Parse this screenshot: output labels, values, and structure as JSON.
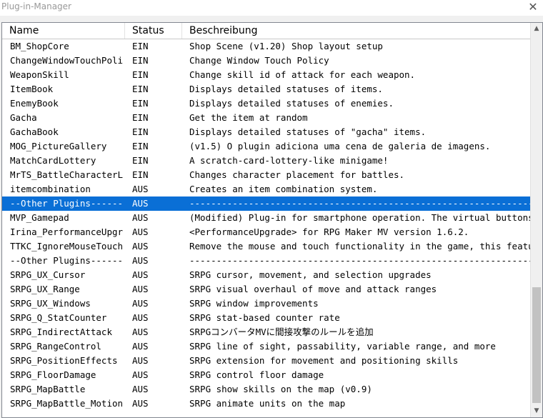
{
  "window": {
    "title": "Plug-in-Manager",
    "close_glyph": "✕"
  },
  "columns": {
    "name": "Name",
    "status": "Status",
    "description": "Beschreibung"
  },
  "scrollbar": {
    "up_glyph": "▲",
    "down_glyph": "▼"
  },
  "plugins": [
    {
      "name": "BM_ShopCore",
      "status": "EIN",
      "description": "Shop Scene (v1.20)  Shop layout setup"
    },
    {
      "name": "ChangeWindowTouchPolicy",
      "status": "EIN",
      "description": "Change Window Touch Policy"
    },
    {
      "name": "WeaponSkill",
      "status": "EIN",
      "description": "Change skill id of attack for each weapon."
    },
    {
      "name": "ItemBook",
      "status": "EIN",
      "description": "Displays detailed statuses of items."
    },
    {
      "name": "EnemyBook",
      "status": "EIN",
      "description": "Displays detailed statuses of enemies."
    },
    {
      "name": "Gacha",
      "status": "EIN",
      "description": "Get the item at random"
    },
    {
      "name": "GachaBook",
      "status": "EIN",
      "description": "Displays detailed statuses of \"gacha\" items."
    },
    {
      "name": "MOG_PictureGallery",
      "status": "EIN",
      "description": "(v1.5) O plugin adiciona uma cena de galeria de imagens."
    },
    {
      "name": "MatchCardLottery",
      "status": "EIN",
      "description": "A scratch-card-lottery-like minigame!"
    },
    {
      "name": "MrTS_BattleCharacterL…",
      "status": "EIN",
      "description": "Changes character placement for battles."
    },
    {
      "name": "itemcombination",
      "status": "AUS",
      "description": "Creates an item combination system."
    },
    {
      "name": "--Other Plugins--------",
      "status": "AUS",
      "description": "--------------------------------------------------------------------------------",
      "selected": true
    },
    {
      "name": "MVP_Gamepad",
      "status": "AUS",
      "description": "(Modified) Plug-in for smartphone operation. The virtual buttons tha…"
    },
    {
      "name": "Irina_PerformanceUpgr…",
      "status": "AUS",
      "description": "<PerformanceUpgrade> for RPG Maker MV version 1.6.2."
    },
    {
      "name": "TTKC_IgnoreMouseTouch",
      "status": "AUS",
      "description": "Remove the mouse and touch functionality in the game, this feature c…"
    },
    {
      "name": "--Other Plugins--------",
      "status": "AUS",
      "description": "--------------------------------------------------------------------------------"
    },
    {
      "name": "SRPG_UX_Cursor",
      "status": "AUS",
      "description": "SRPG cursor, movement, and selection upgrades"
    },
    {
      "name": "SRPG_UX_Range",
      "status": "AUS",
      "description": "SRPG visual overhaul of move and attack ranges"
    },
    {
      "name": "SRPG_UX_Windows",
      "status": "AUS",
      "description": "SRPG window improvements"
    },
    {
      "name": "SRPG_Q_StatCounter",
      "status": "AUS",
      "description": "SRPG stat-based counter rate"
    },
    {
      "name": "SRPG_IndirectAttack",
      "status": "AUS",
      "description": "SRPGコンバータMVに間接攻撃のルールを追加"
    },
    {
      "name": "SRPG_RangeControl",
      "status": "AUS",
      "description": "SRPG line of sight, passability, variable range, and more"
    },
    {
      "name": "SRPG_PositionEffects",
      "status": "AUS",
      "description": "SRPG extension for movement and positioning skills"
    },
    {
      "name": "SRPG_FloorDamage",
      "status": "AUS",
      "description": "SRPG control floor damage"
    },
    {
      "name": "SRPG_MapBattle",
      "status": "AUS",
      "description": "SRPG show skills on the map (v0.9)"
    },
    {
      "name": "SRPG_MapBattle_Motions",
      "status": "AUS",
      "description": "SRPG animate units on the map"
    }
  ]
}
